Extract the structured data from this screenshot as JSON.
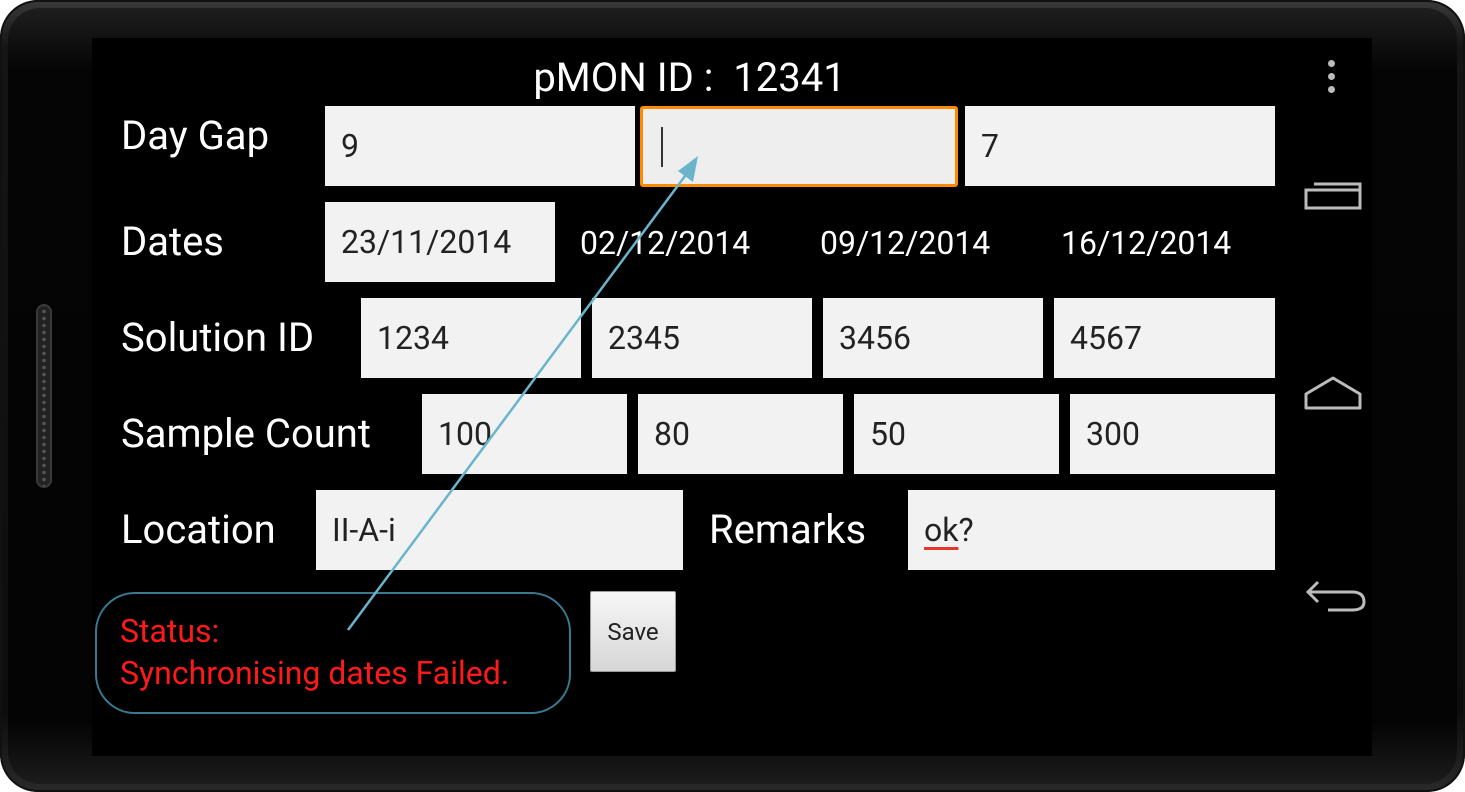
{
  "header": {
    "title": "pMON ID :  12341"
  },
  "rows": {
    "day_gap": {
      "label": "Day Gap",
      "fields": [
        "9",
        "",
        "7"
      ]
    },
    "dates": {
      "label": "Dates",
      "field": "23/11/2014",
      "values": [
        "02/12/2014",
        "09/12/2014",
        "16/12/2014"
      ]
    },
    "solution_id": {
      "label": "Solution ID",
      "fields": [
        "1234",
        "2345",
        "3456",
        "4567"
      ]
    },
    "sample_count": {
      "label": "Sample Count",
      "fields": [
        "100",
        "80",
        "50",
        "300"
      ]
    },
    "location": {
      "label": "Location",
      "value": "II-A-i"
    },
    "remarks": {
      "label": "Remarks",
      "word": "ok",
      "suffix": "?"
    }
  },
  "status": {
    "line1": "Status:",
    "line2": "Synchronising dates Failed."
  },
  "save_button": {
    "label": "Save"
  },
  "nav": {
    "icons": [
      "overflow-menu-icon",
      "recent-apps-icon",
      "home-icon",
      "back-icon"
    ]
  },
  "colors": {
    "focus_border": "#ff8a00",
    "status_text": "#ff1a1a",
    "annotation": "#6ab4cc",
    "spell_underline": "#e5372e"
  }
}
